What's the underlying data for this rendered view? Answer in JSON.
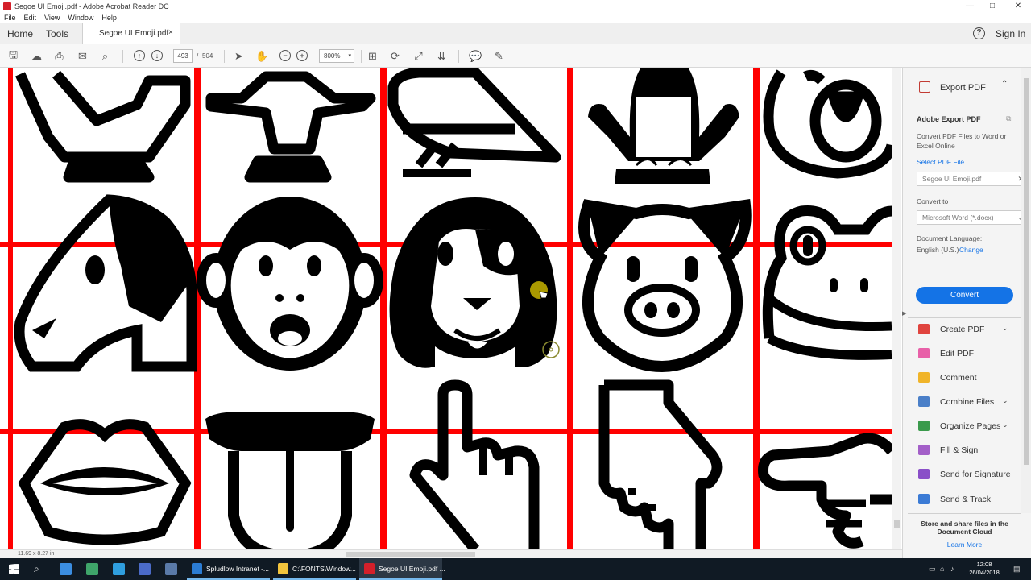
{
  "window": {
    "title": "Segoe UI Emoji.pdf - Adobe Acrobat Reader DC",
    "controls": [
      "—",
      "□",
      "✕"
    ]
  },
  "menu": [
    "File",
    "Edit",
    "View",
    "Window",
    "Help"
  ],
  "tabs": {
    "home": "Home",
    "tools": "Tools",
    "document": "Segoe UI Emoji.pdf",
    "close": "×"
  },
  "header_right": {
    "sign_in": "Sign In",
    "help": "?"
  },
  "toolbar": {
    "page_current": "493",
    "page_separator": "/",
    "page_total": "504",
    "zoom": "800%"
  },
  "status": {
    "page_size": "11.69 x 8.27 in"
  },
  "right_pane": {
    "export_title": "Export PDF",
    "section_title": "Adobe Export PDF",
    "description": "Convert PDF Files to Word or Excel Online",
    "select_file": "Select PDF File",
    "file_name": "Segoe UI Emoji.pdf",
    "convert_to_label": "Convert to",
    "convert_to_value": "Microsoft Word (*.docx)",
    "doc_language_label": "Document Language:",
    "doc_language_value": "English (U.S.)",
    "change_link": "Change",
    "convert_button": "Convert",
    "tools": [
      {
        "label": "Create PDF",
        "icon": "create-pdf-icon",
        "color": "#e0443e",
        "expandable": true
      },
      {
        "label": "Edit PDF",
        "icon": "edit-pdf-icon",
        "color": "#e860a8",
        "expandable": false
      },
      {
        "label": "Comment",
        "icon": "comment-icon",
        "color": "#f0b429",
        "expandable": false
      },
      {
        "label": "Combine Files",
        "icon": "combine-files-icon",
        "color": "#4a7fc8",
        "expandable": true
      },
      {
        "label": "Organize Pages",
        "icon": "organize-pages-icon",
        "color": "#3a9a4c",
        "expandable": true
      },
      {
        "label": "Fill & Sign",
        "icon": "fill-sign-icon",
        "color": "#a35fc8",
        "expandable": false
      },
      {
        "label": "Send for Signature",
        "icon": "send-signature-icon",
        "color": "#8a4fc8",
        "expandable": false
      },
      {
        "label": "Send & Track",
        "icon": "send-track-icon",
        "color": "#3b7bd5",
        "expandable": false
      }
    ],
    "footer_text": "Store and share files in the Document Cloud",
    "footer_link": "Learn More"
  },
  "taskbar": {
    "items": [
      {
        "label": "Spludlow Intranet -...",
        "icon": "edge-icon",
        "color": "#2b7cd3"
      },
      {
        "label": "C:\\FONTS\\Window...",
        "icon": "folder-icon",
        "color": "#f3c53d"
      },
      {
        "label": "Segoe UI Emoji.pdf ...",
        "icon": "acrobat-icon",
        "color": "#d4202a"
      }
    ],
    "time": "12:08",
    "date": "26/04/2018"
  },
  "colors": {
    "accent": "#1473e6",
    "grid_red": "#ff0000",
    "taskbar": "#101a24"
  }
}
